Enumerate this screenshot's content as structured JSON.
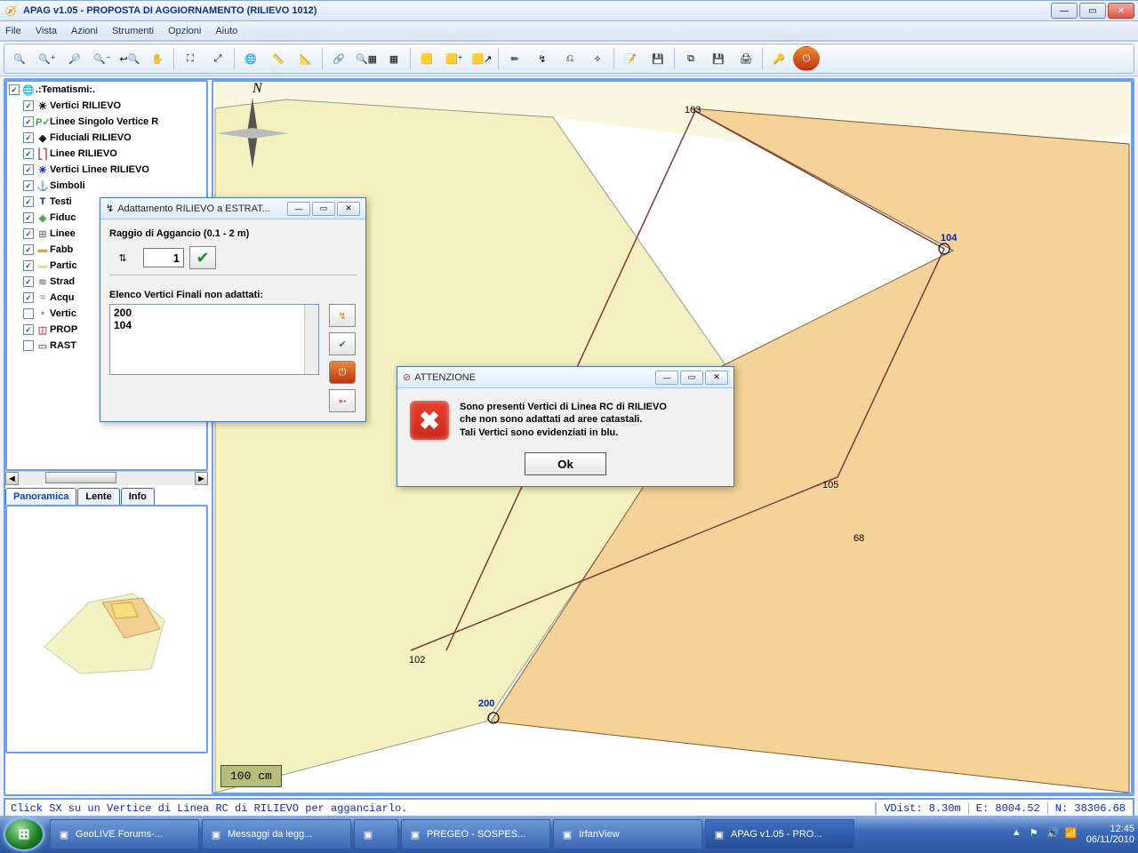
{
  "window": {
    "title": "APAG v1.05 - PROPOSTA DI AGGIORNAMENTO (RILIEVO 1012)"
  },
  "menu": {
    "items": [
      "File",
      "Vista",
      "Azioni",
      "Strumenti",
      "Opzioni",
      "Aiuto"
    ]
  },
  "layers": {
    "title": ".:Tematismi:.",
    "items": [
      {
        "checked": true,
        "sym": "✳",
        "color": "#000",
        "label": "Vertici RILIEVO"
      },
      {
        "checked": true,
        "sym": "P✓",
        "color": "#3aa53a",
        "label": "Linee Singolo Vertice R"
      },
      {
        "checked": true,
        "sym": "◈",
        "color": "#000",
        "label": "Fiduciali RILIEVO"
      },
      {
        "checked": true,
        "sym": "⎣⎤",
        "color": "#d04040",
        "label": "Linee RILIEVO"
      },
      {
        "checked": true,
        "sym": "✳",
        "color": "#0020c0",
        "label": "Vertici Linee RILIEVO"
      },
      {
        "checked": true,
        "sym": "⚓",
        "color": "#0020c0",
        "label": "Simboli"
      },
      {
        "checked": true,
        "sym": "T",
        "color": "#0020c0",
        "label": "Testi"
      },
      {
        "checked": true,
        "sym": "◈",
        "color": "#3aa53a",
        "label": "Fiduc"
      },
      {
        "checked": true,
        "sym": "⊞",
        "color": "#888",
        "label": "Linee"
      },
      {
        "checked": true,
        "sym": "▬",
        "color": "#d9a441",
        "label": "Fabb"
      },
      {
        "checked": true,
        "sym": "▬",
        "color": "#e5e07a",
        "label": "Partic"
      },
      {
        "checked": true,
        "sym": "≋",
        "color": "#888",
        "label": "Strad"
      },
      {
        "checked": true,
        "sym": "≈",
        "color": "#5ab0d0",
        "label": "Acqu"
      },
      {
        "checked": false,
        "sym": "•",
        "color": "#888",
        "label": "Vertic"
      },
      {
        "checked": true,
        "sym": "◫",
        "color": "#d04040",
        "label": "PROP"
      },
      {
        "checked": false,
        "sym": "▭",
        "color": "#777",
        "label": "RAST"
      }
    ]
  },
  "bottom_tabs": {
    "items": [
      "Panoramica",
      "Lente",
      "Info"
    ],
    "active": 0
  },
  "scale": {
    "label": "100 cm"
  },
  "nodes": {
    "n103": "103",
    "n104": "104",
    "n105": "105",
    "n68": "68",
    "n102": "102",
    "n200": "200"
  },
  "dialogs": {
    "adat": {
      "title": "Adattamento RILIEVO a ESTRAT...",
      "radius_label": "Raggio di Aggancio (0.1 - 2 m)",
      "radius_value": "1",
      "list_label": "Elenco Vertici Finali non adattati:",
      "list": [
        "200",
        "104"
      ]
    },
    "alert": {
      "title": "ATTENZIONE",
      "line1": "Sono presenti Vertici di Linea RC di RILIEVO",
      "line2": "che non sono adattati ad aree catastali.",
      "line3": "Tali Vertici sono evidenziati in blu.",
      "ok": "Ok"
    }
  },
  "status": {
    "hint": "Click SX su un Vertice di Linea RC di RILIEVO per agganciarlo.",
    "vdist": "VDist: 8.30m",
    "east": "E: 8004.52",
    "north": "N: 38306.68"
  },
  "taskbar": {
    "items": [
      {
        "icon": "e-icon",
        "label": "GeoLIVE Forums-..."
      },
      {
        "icon": "folder-icon",
        "label": "Messaggi da legg..."
      },
      {
        "icon": "explorer-icon",
        "label": ""
      },
      {
        "icon": "pregeo-icon",
        "label": "PREGEO - SOSPES..."
      },
      {
        "icon": "irfan-icon",
        "label": "IrfanView"
      },
      {
        "icon": "apag-icon",
        "label": "APAG v1.05 - PRO...",
        "active": true
      }
    ],
    "clock_time": "12:45",
    "clock_date": "06/11/2010"
  }
}
